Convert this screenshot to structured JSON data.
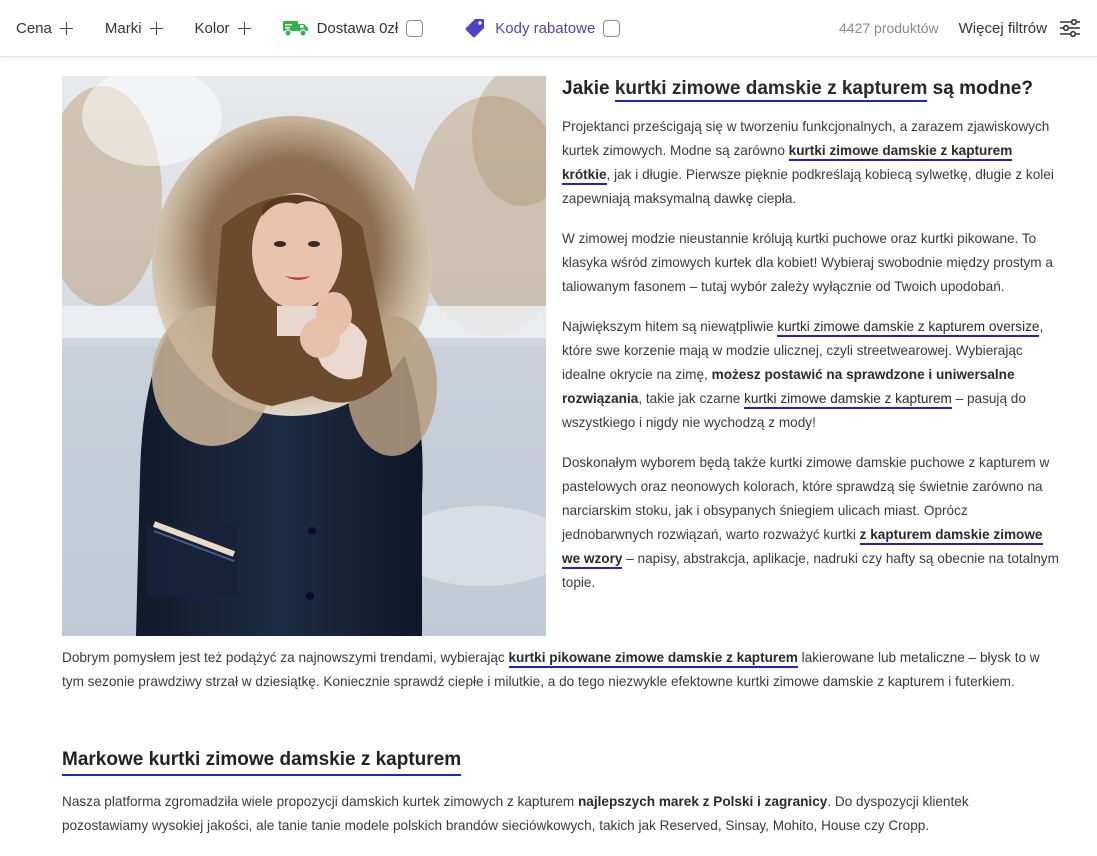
{
  "filters": {
    "price": "Cena",
    "brands": "Marki",
    "color": "Kolor",
    "delivery": "Dostawa 0zł",
    "discount_codes": "Kody rabatowe",
    "product_count": "4427 produktów",
    "more_filters": "Więcej filtrów"
  },
  "colors": {
    "accent": "#1f22c9",
    "delivery_icon": "#2db34a",
    "discount": "#5140c8"
  },
  "article": {
    "h1": {
      "pre": "Jakie ",
      "link": "kurtki zimowe damskie z kapturem",
      "post": " są modne?"
    },
    "p1": {
      "t1": "Projektanci prześcigają się w tworzeniu funkcjonalnych, a zarazem zjawiskowych kurtek zimowych. Modne są zarówno ",
      "link": "kurtki zimowe damskie z kapturem krótkie",
      "t2": ", jak i długie. Pierwsze pięknie podkreślają kobiecą sylwetkę, długie z kolei zapewniają maksymalną dawkę ciepła."
    },
    "p2": "W zimowej modzie nieustannie królują kurtki puchowe oraz kurtki pikowane. To klasyka wśród zimowych kurtek dla kobiet! Wybieraj swobodnie między prostym a taliowanym fasonem – tutaj wybór zależy wyłącznie od Twoich upodobań.",
    "p3": {
      "t1": "Największym hitem są niewątpliwie ",
      "link1": "kurtki zimowe damskie z kapturem oversize",
      "t2": ", które swe korzenie mają w modzie ulicznej, czyli streetwearowej. Wybierając idealne okrycie na zimę, ",
      "bold": "możesz postawić na sprawdzone i uniwersalne rozwiązania",
      "t3": ", takie jak czarne ",
      "link2": "kurtki zimowe damskie z kapturem",
      "t4": " – pasują do wszystkiego i nigdy nie wychodzą z mody!"
    },
    "p4": {
      "t1": "Doskonałym wyborem będą także kurtki zimowe damskie puchowe z kapturem w pastelowych oraz neonowych kolorach, które sprawdzą się świetnie zarówno na narciarskim stoku, jak i obsypanych śniegiem ulicach miast. Oprócz jednobarwnych rozwiązań, warto rozważyć kurtki ",
      "link": "z kapturem damskie zimowe we wzory",
      "t2": " – napisy, abstrakcja, aplikacje, nadruki czy hafty są obecnie na totalnym topie."
    },
    "p5": {
      "t1": "Dobrym pomysłem jest też podążyć za najnowszymi trendami, wybierając ",
      "link": "kurtki pikowane zimowe damskie z kapturem",
      "t2": " lakierowane lub metaliczne – błysk to w tym sezonie prawdziwy strzał w dziesiątkę. Koniecznie sprawdź ciepłe i milutkie, a do tego niezwykle efektowne kurtki zimowe damskie z kapturem i futerkiem."
    },
    "h2": "Markowe kurtki zimowe damskie z kapturem",
    "p6": {
      "t1": "Nasza platforma zgromadziła wiele propozycji damskich kurtek zimowych z kapturem ",
      "bold": "najlepszych marek z Polski i zagranicy",
      "t2": ". Do dyspozycji klientek pozostawiamy wysokiej jakości, ale tanie tanie modele polskich brandów sieciówkowych, takich jak Reserved, Sinsay, Mohito, House czy Cropp."
    }
  }
}
